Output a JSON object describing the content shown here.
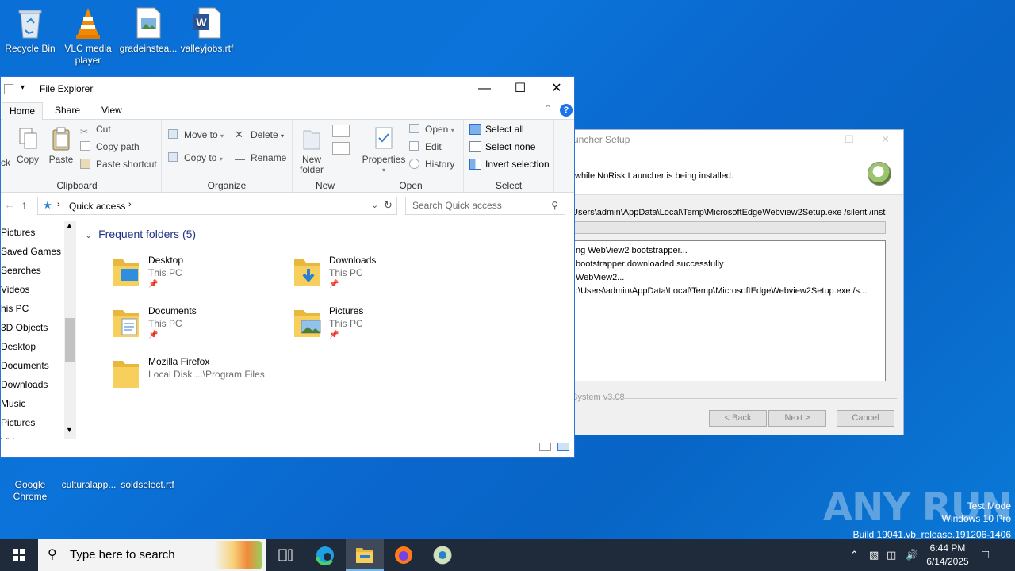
{
  "desktop": {
    "icons": [
      {
        "label": "Recycle Bin"
      },
      {
        "label": "VLC media player"
      },
      {
        "label": "gradeinstea..."
      },
      {
        "label": "valleyjobs.rtf"
      },
      {
        "label": "Google Chrome"
      },
      {
        "label": "culturalapp..."
      },
      {
        "label": "soldselect.rtf"
      }
    ]
  },
  "setup": {
    "title": "uncher Setup",
    "subtitle": "while NoRisk Launcher is being installed.",
    "command": "Users\\admin\\AppData\\Local\\Temp\\MicrosoftEdgeWebview2Setup.exe /silent /inst",
    "log": [
      "ng WebView2 bootstrapper...",
      " bootstrapper downloaded successfully",
      " WebView2...",
      ":\\Users\\admin\\AppData\\Local\\Temp\\MicrosoftEdgeWebview2Setup.exe /s..."
    ],
    "brand": "System v3.08",
    "back_label": "< Back",
    "next_label": "Next >",
    "cancel_label": "Cancel"
  },
  "explorer": {
    "title": "File Explorer",
    "tabs": {
      "home": "Home",
      "share": "Share",
      "view": "View"
    },
    "ribbon": {
      "clipboard": {
        "label": "Clipboard",
        "pin": "ck",
        "copy": "Copy",
        "paste": "Paste",
        "cut": "Cut",
        "copy_path": "Copy path",
        "paste_shortcut": "Paste shortcut"
      },
      "organize": {
        "label": "Organize",
        "move_to": "Move to",
        "copy_to": "Copy to",
        "delete": "Delete",
        "rename": "Rename"
      },
      "new": {
        "label": "New",
        "new_folder_1": "New",
        "new_folder_2": "folder"
      },
      "open": {
        "label": "Open",
        "properties": "Properties",
        "open": "Open",
        "edit": "Edit",
        "history": "History"
      },
      "select": {
        "label": "Select",
        "select_all": "Select all",
        "select_none": "Select none",
        "invert": "Invert selection"
      }
    },
    "address": {
      "location": "Quick access",
      "search_placeholder": "Search Quick access"
    },
    "nav": [
      "Pictures",
      "Saved Games",
      "Searches",
      "Videos",
      "his PC",
      "3D Objects",
      "Desktop",
      "Documents",
      "Downloads",
      "Music",
      "Pictures",
      "Videos"
    ],
    "section_title": "Frequent folders (5)",
    "folders": [
      {
        "name": "Desktop",
        "location": "This PC",
        "icon": "desktop-folder-icon"
      },
      {
        "name": "Downloads",
        "location": "This PC",
        "icon": "downloads-folder-icon"
      },
      {
        "name": "Documents",
        "location": "This PC",
        "icon": "documents-folder-icon"
      },
      {
        "name": "Pictures",
        "location": "This PC",
        "icon": "pictures-folder-icon"
      },
      {
        "name": "Mozilla Firefox",
        "location": "Local Disk ...\\Program Files",
        "icon": "folder-icon"
      }
    ]
  },
  "taskbar": {
    "search_placeholder": "Type here to search",
    "time": "6:44 PM",
    "date": "6/14/2025"
  },
  "watermark": {
    "line1": "Test Mode",
    "line2": "Windows 10 Pro",
    "line3": "Build 19041.vb_release.191206-1406",
    "brand": "ANY RUN"
  },
  "colors": {
    "accent": "#0078d7",
    "taskbar": "#1f2a3a",
    "folder": "#f3c34a"
  }
}
